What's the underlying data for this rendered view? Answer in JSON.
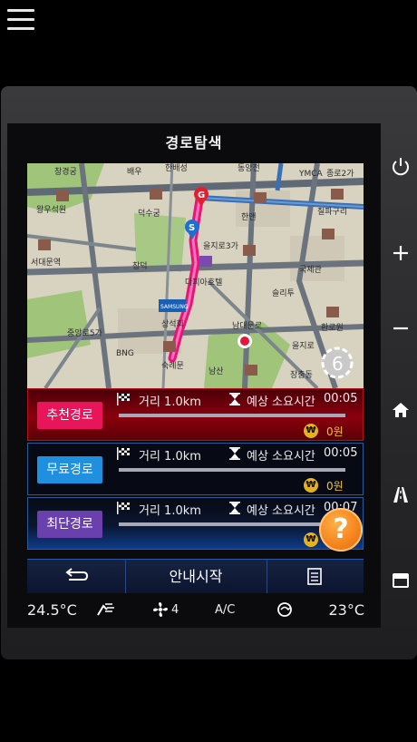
{
  "header": {
    "title": "경로탐색"
  },
  "map": {
    "labels": [
      "창경궁",
      "배우",
      "한배성",
      "동양전",
      "YMCA",
      "종로2가",
      "왕우석원",
      "덕수궁",
      "한앤",
      "칠파구리",
      "서대문역",
      "을지로3가",
      "창덕",
      "다피아호텔",
      "국제관",
      "슬리투",
      "상석회",
      "남대문로",
      "중앙로5가",
      "을지로",
      "환로원",
      "BNG",
      "숙례문",
      "남산",
      "장충동"
    ],
    "markers": {
      "start": "S",
      "goal": "G"
    },
    "zoom_badge": "6",
    "brand": "SAMSUNG"
  },
  "routes": [
    {
      "name": "추천경로",
      "distance": "거리 1.0km",
      "eta_label": "예상 소요시간",
      "eta": "00:05",
      "currency": "₩",
      "fare": "0원"
    },
    {
      "name": "무료경로",
      "distance": "거리 1.0km",
      "eta_label": "예상 소요시간",
      "eta": "00:05",
      "currency": "₩",
      "fare": "0원"
    },
    {
      "name": "최단경로",
      "distance": "거리 1.0km",
      "eta_label": "예상 소요시간",
      "eta": "00:07",
      "currency": "₩",
      "fare": "0원"
    }
  ],
  "help": {
    "label": "?"
  },
  "actions": {
    "start_label": "안내시작"
  },
  "climate": {
    "left_temp": "24.5°C",
    "fan_level": "4",
    "ac": "A/C",
    "right_temp": "23°C"
  },
  "colors": {
    "recommended": "#e8155a",
    "free": "#1f8fe0",
    "shortest": "#6a3fae",
    "accent": "#f5841e"
  }
}
